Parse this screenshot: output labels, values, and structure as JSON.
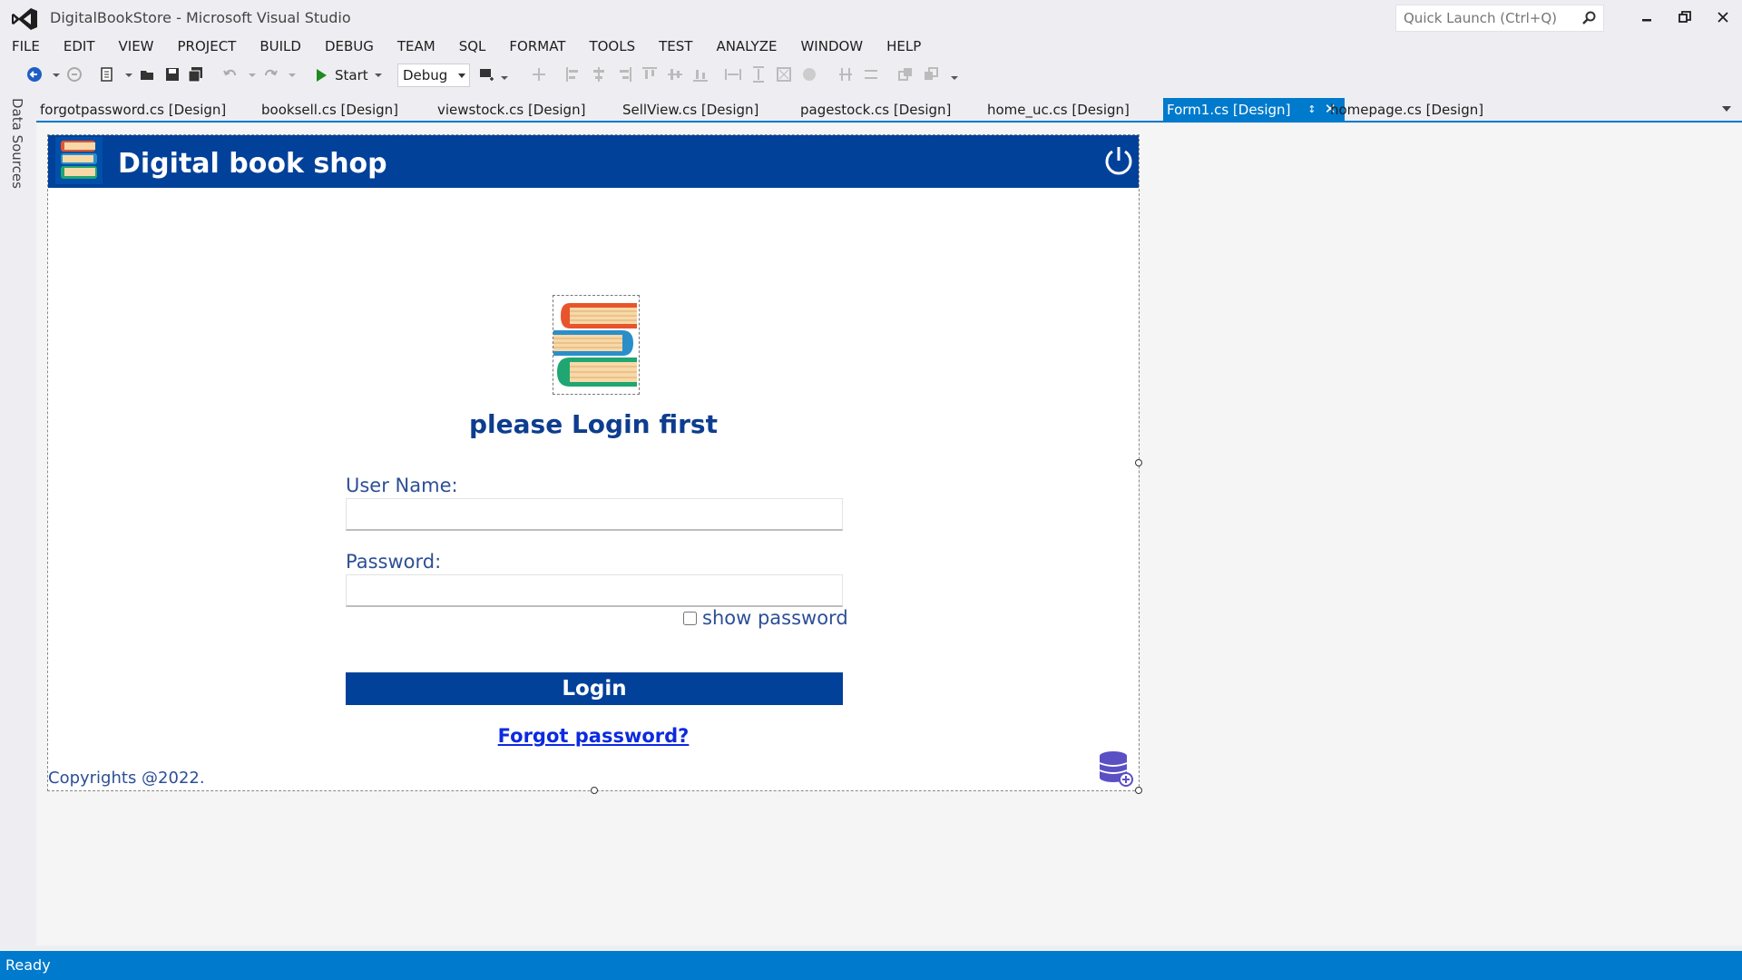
{
  "window": {
    "title": "DigitalBookStore - Microsoft Visual Studio",
    "quick_launch_placeholder": "Quick Launch (Ctrl+Q)"
  },
  "menu": [
    "FILE",
    "EDIT",
    "VIEW",
    "PROJECT",
    "BUILD",
    "DEBUG",
    "TEAM",
    "SQL",
    "FORMAT",
    "TOOLS",
    "TEST",
    "ANALYZE",
    "WINDOW",
    "HELP"
  ],
  "toolbar": {
    "start_label": "Start",
    "configuration": "Debug"
  },
  "side_panel": {
    "label": "Data Sources"
  },
  "tabs": [
    {
      "label": "forgotpassword.cs [Design]",
      "active": false
    },
    {
      "label": "booksell.cs [Design]",
      "active": false
    },
    {
      "label": "viewstock.cs [Design]",
      "active": false
    },
    {
      "label": "SellView.cs [Design]",
      "active": false
    },
    {
      "label": "pagestock.cs [Design]",
      "active": false
    },
    {
      "label": "home_uc.cs [Design]",
      "active": false
    },
    {
      "label": "Form1.cs [Design]",
      "active": true
    },
    {
      "label": "homepage.cs [Design]",
      "active": false
    }
  ],
  "form": {
    "header_title": "Digital book shop",
    "login_title": "please Login first",
    "username_label": "User Name:",
    "username_value": "",
    "password_label": "Password:",
    "password_value": "",
    "show_password_label": "show password",
    "show_password_checked": false,
    "login_button": "Login",
    "forgot_link": "Forgot password?",
    "copyright": "Copyrights @2022."
  },
  "status": {
    "text": "Ready"
  },
  "colors": {
    "accent": "#007acc",
    "form_header": "#01419a",
    "form_text": "#2d4f96",
    "link": "#0c2adf"
  }
}
